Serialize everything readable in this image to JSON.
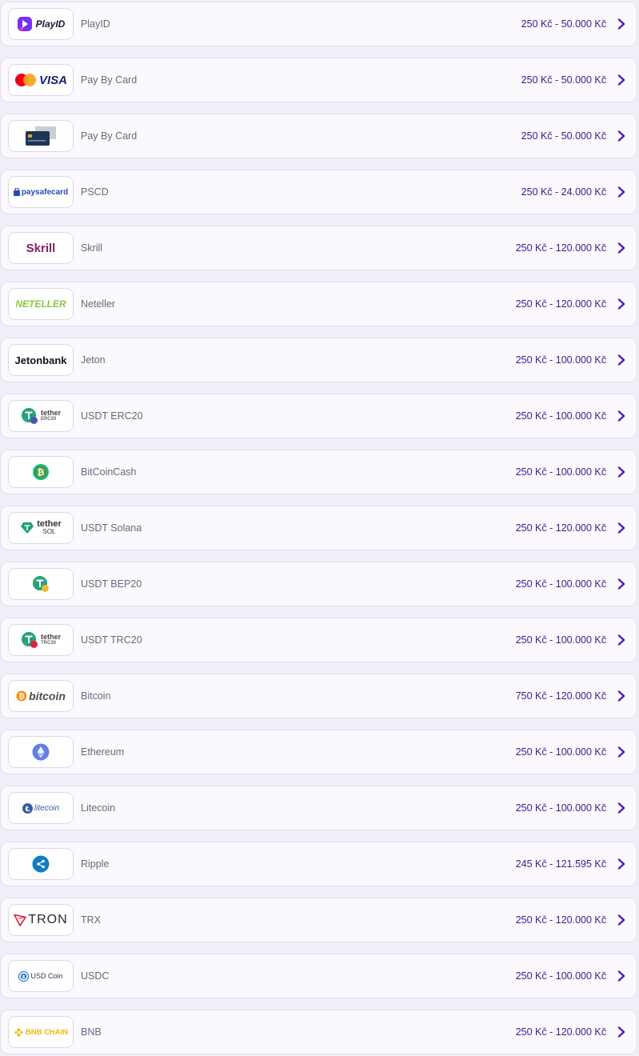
{
  "accent_color": "#5a14c8",
  "chevron_icon": "chevron-right-icon",
  "methods": [
    {
      "id": "playid",
      "name": "PlayID",
      "range": "250 Kč - 50.000 Kč",
      "logo_text": "PlayID",
      "logo_icon": "playid-icon"
    },
    {
      "id": "visa-mc",
      "name": "Pay By Card",
      "range": "250 Kč - 50.000 Kč",
      "logo_text": "VISA",
      "logo_icon": "mastercard-visa-icon"
    },
    {
      "id": "card",
      "name": "Pay By Card",
      "range": "250 Kč - 50.000 Kč",
      "logo_text": "",
      "logo_icon": "credit-card-icon"
    },
    {
      "id": "pscd",
      "name": "PSCD",
      "range": "250 Kč - 24.000 Kč",
      "logo_text": "paysafecard",
      "logo_icon": "paysafecard-icon"
    },
    {
      "id": "skrill",
      "name": "Skrill",
      "range": "250 Kč - 120.000 Kč",
      "logo_text": "Skrill",
      "logo_icon": "skrill-icon"
    },
    {
      "id": "neteller",
      "name": "Neteller",
      "range": "250 Kč - 120.000 Kč",
      "logo_text": "NETELLER",
      "logo_icon": "neteller-icon"
    },
    {
      "id": "jeton",
      "name": "Jeton",
      "range": "250 Kč - 100.000 Kč",
      "logo_text": "Jetonbank",
      "logo_icon": "jetonbank-icon"
    },
    {
      "id": "usdt-erc20",
      "name": "USDT ERC20",
      "range": "250 Kč - 100.000 Kč",
      "logo_text": "tether",
      "logo_sub": "ERC20",
      "logo_icon": "tether-erc20-icon"
    },
    {
      "id": "bch",
      "name": "BitCoinCash",
      "range": "250 Kč - 100.000 Kč",
      "logo_text": "",
      "logo_icon": "bitcoin-cash-icon"
    },
    {
      "id": "usdt-sol",
      "name": "USDT Solana",
      "range": "250 Kč - 120.000 Kč",
      "logo_text": "tether",
      "logo_sub": "SOL",
      "logo_icon": "tether-sol-icon"
    },
    {
      "id": "usdt-bep20",
      "name": "USDT BEP20",
      "range": "250 Kč - 100.000 Kč",
      "logo_text": "",
      "logo_icon": "tether-bep20-icon"
    },
    {
      "id": "usdt-trc20",
      "name": "USDT TRC20",
      "range": "250 Kč - 100.000 Kč",
      "logo_text": "tether",
      "logo_sub": "TRC20",
      "logo_icon": "tether-trc20-icon"
    },
    {
      "id": "bitcoin",
      "name": "Bitcoin",
      "range": "750 Kč - 120.000 Kč",
      "logo_text": "bitcoin",
      "logo_icon": "bitcoin-icon"
    },
    {
      "id": "ethereum",
      "name": "Ethereum",
      "range": "250 Kč - 100.000 Kč",
      "logo_text": "",
      "logo_icon": "ethereum-icon"
    },
    {
      "id": "litecoin",
      "name": "Litecoin",
      "range": "250 Kč - 100.000 Kč",
      "logo_text": "litecoin",
      "logo_icon": "litecoin-icon"
    },
    {
      "id": "ripple",
      "name": "Ripple",
      "range": "245 Kč - 121.595 Kč",
      "logo_text": "",
      "logo_icon": "ripple-icon"
    },
    {
      "id": "trx",
      "name": "TRX",
      "range": "250 Kč - 120.000 Kč",
      "logo_text": "TRON",
      "logo_icon": "tron-icon"
    },
    {
      "id": "usdc",
      "name": "USDC",
      "range": "250 Kč - 100.000 Kč",
      "logo_text": "USD Coin",
      "logo_icon": "usd-coin-icon"
    },
    {
      "id": "bnb",
      "name": "BNB",
      "range": "250 Kč - 120.000 Kč",
      "logo_text": "BNB CHAIN",
      "logo_icon": "bnb-chain-icon"
    }
  ]
}
